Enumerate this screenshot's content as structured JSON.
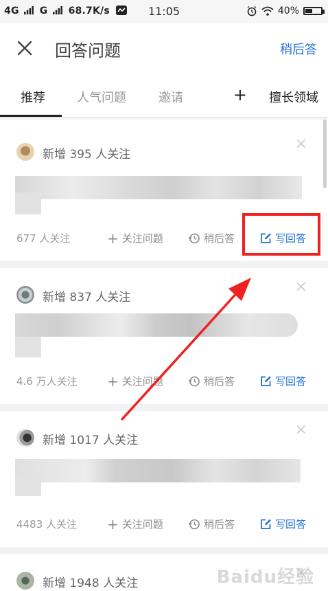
{
  "status": {
    "network_left": "4G",
    "network_mid": "G",
    "speed": "68.7K/s",
    "time": "11:05",
    "battery": "40%"
  },
  "header": {
    "title": "回答问题",
    "later": "稍后答"
  },
  "tabs": [
    {
      "label": "推荐",
      "active": true
    },
    {
      "label": "人气问题",
      "active": false
    },
    {
      "label": "邀请",
      "active": false
    }
  ],
  "tab_expert": "擅长领域",
  "cards": [
    {
      "headline": "新增 395 人关注",
      "followers": "677 人关注",
      "follow": "关注问题",
      "later": "稍后答",
      "write": "写回答"
    },
    {
      "headline": "新增 837 人关注",
      "followers": "4.6 万人关注",
      "follow": "关注问题",
      "later": "稍后答",
      "write": "写回答"
    },
    {
      "headline": "新增 1017 人关注",
      "followers": "4483 人关注",
      "follow": "关注问题",
      "later": "稍后答",
      "write": "写回答"
    },
    {
      "headline": "新增 1948 人关注"
    }
  ],
  "colors": {
    "accent": "#1e6fd9",
    "highlight": "#ee2222"
  },
  "watermark": "Baidu经验"
}
